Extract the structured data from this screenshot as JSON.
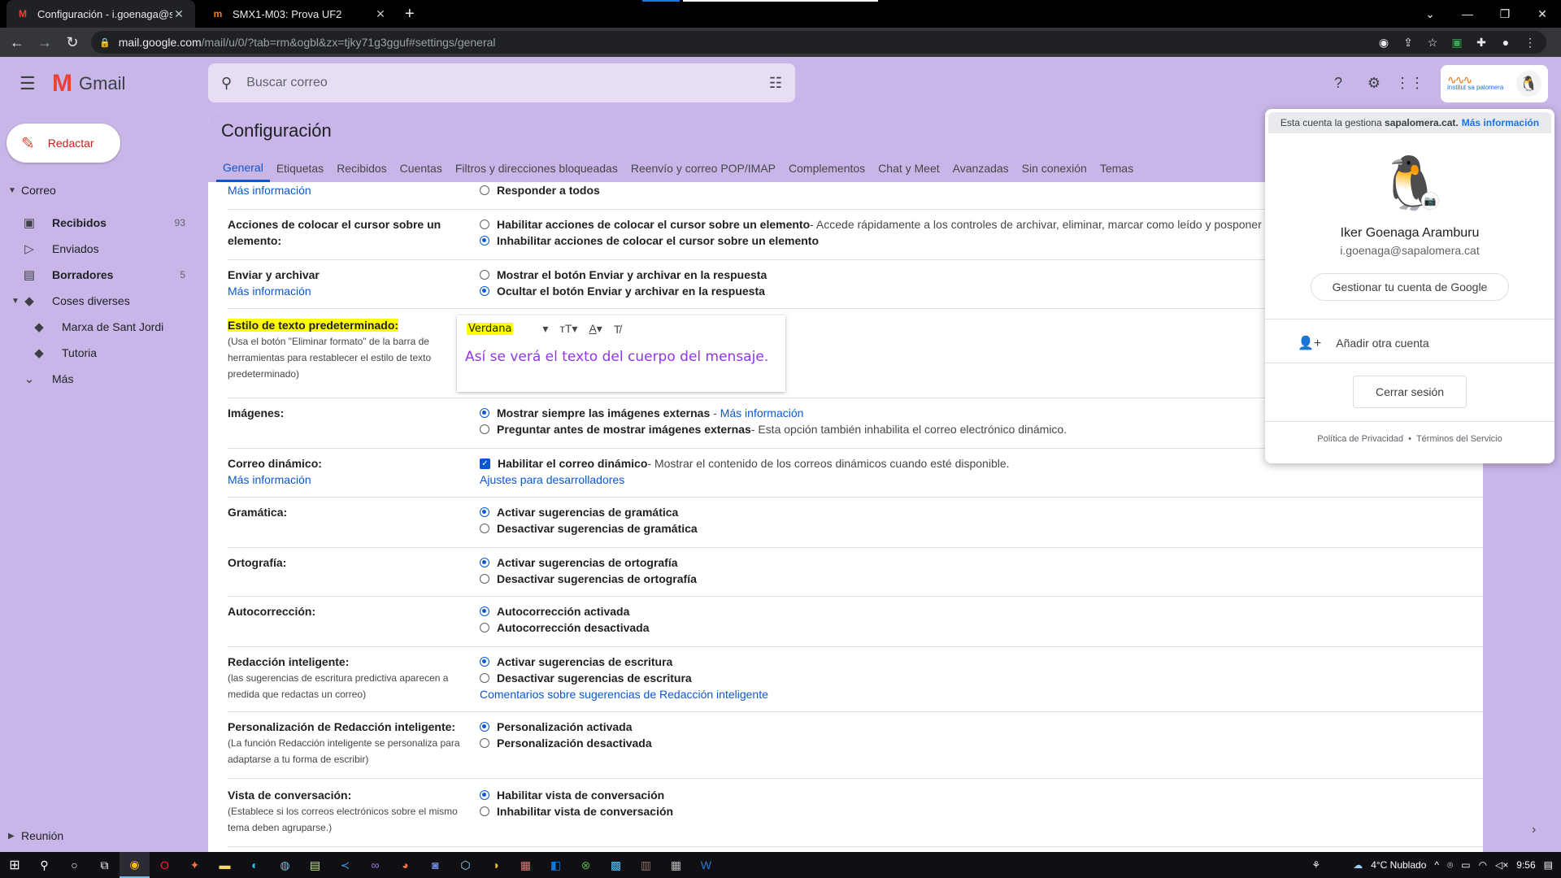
{
  "browser": {
    "tabs": [
      {
        "title": "Configuración - i.goenaga@sapa",
        "favicon": "gmail-m-icon",
        "active": true
      },
      {
        "title": "SMX1-M03: Prova UF2",
        "favicon": "moodle-m-icon",
        "active": false
      }
    ],
    "url_host": "mail.google.com",
    "url_path": "/mail/u/0/?tab=rm&ogbl&zx=tjky71g3gguf#settings/general"
  },
  "gmail": {
    "logo_text": "Gmail",
    "search_placeholder": "Buscar correo",
    "compose_label": "Redactar",
    "org_badge_text": "institut sa palomera"
  },
  "sidebar": {
    "section_mail": "Correo",
    "items": [
      {
        "label": "Recibidos",
        "count": "93",
        "icon": "inbox-icon",
        "bold": true
      },
      {
        "label": "Enviados",
        "count": "",
        "icon": "send-icon",
        "bold": false
      },
      {
        "label": "Borradores",
        "count": "5",
        "icon": "draft-icon",
        "bold": true
      },
      {
        "label": "Coses diverses",
        "count": "",
        "icon": "label-icon",
        "bold": false
      },
      {
        "label": "Marxa de Sant Jordi",
        "count": "",
        "icon": "label-icon",
        "bold": false
      },
      {
        "label": "Tutoria",
        "count": "",
        "icon": "label-icon",
        "bold": false
      },
      {
        "label": "Más",
        "count": "",
        "icon": "chevron-down-icon",
        "bold": false
      }
    ],
    "section_meet": "Reunión"
  },
  "settings": {
    "title": "Configuración",
    "tabs": [
      "General",
      "Etiquetas",
      "Recibidos",
      "Cuentas",
      "Filtros y direcciones bloqueadas",
      "Reenvío y correo POP/IMAP",
      "Complementos",
      "Chat y Meet",
      "Avanzadas",
      "Sin conexión",
      "Temas"
    ],
    "rows": {
      "reply": {
        "label_link": "Más información",
        "opt1": "Responder a todos"
      },
      "hover": {
        "label": "Acciones de colocar el cursor sobre un elemento:",
        "opt1": "Habilitar acciones de colocar el cursor sobre un elemento",
        "opt1_desc": " - Accede rápidamente a los controles de archivar, eliminar, marcar como leído y posponer",
        "opt2": "Inhabilitar acciones de colocar el cursor sobre un elemento"
      },
      "sendarchive": {
        "label": "Enviar y archivar",
        "label_link": "Más información",
        "opt1": "Mostrar el botón Enviar y archivar en la respuesta",
        "opt2": "Ocultar el botón Enviar y archivar en la respuesta"
      },
      "textstyle": {
        "label": "Estilo de texto predeterminado:",
        "sub": "(Usa el botón \"Eliminar formato\" de la barra de herramientas para restablecer el estilo de texto predeterminado)",
        "font": "Verdana",
        "preview": "Así se verá el texto del cuerpo del mensaje."
      },
      "images": {
        "label": "Imágenes:",
        "opt1": "Mostrar siempre las imágenes externas",
        "opt1_link": "Más información",
        "opt2": "Preguntar antes de mostrar imágenes externas",
        "opt2_desc": " - Esta opción también inhabilita el correo electrónico dinámico."
      },
      "dynamic": {
        "label": "Correo dinámico:",
        "label_link": "Más información",
        "opt1": "Habilitar el correo dinámico",
        "opt1_desc": " - Mostrar el contenido de los correos dinámicos cuando esté disponible.",
        "link2": "Ajustes para desarrolladores"
      },
      "grammar": {
        "label": "Gramática:",
        "opt1": "Activar sugerencias de gramática",
        "opt2": "Desactivar sugerencias de gramática"
      },
      "spelling": {
        "label": "Ortografía:",
        "opt1": "Activar sugerencias de ortografía",
        "opt2": "Desactivar sugerencias de ortografía"
      },
      "autocorrect": {
        "label": "Autocorrección:",
        "opt1": "Autocorrección activada",
        "opt2": "Autocorrección desactivada"
      },
      "smartcompose": {
        "label": "Redacción inteligente:",
        "sub": "(las sugerencias de escritura predictiva aparecen a medida que redactas un correo)",
        "opt1": "Activar sugerencias de escritura",
        "opt2": "Desactivar sugerencias de escritura",
        "link": "Comentarios sobre sugerencias de Redacción inteligente"
      },
      "personalization": {
        "label": "Personalización de Redacción inteligente:",
        "sub": "(La función Redacción inteligente se personaliza para adaptarse a tu forma de escribir)",
        "opt1": "Personalización activada",
        "opt2": "Personalización desactivada"
      },
      "conversation": {
        "label": "Vista de conversación:",
        "sub": "(Establece si los correos electrónicos sobre el mismo tema deben agruparse.)",
        "opt1": "Habilitar vista de conversación",
        "opt2": "Inhabilitar vista de conversación"
      }
    }
  },
  "account": {
    "managed_text": "Esta cuenta la gestiona",
    "managed_domain": "sapalomera.cat.",
    "managed_link": "Más información",
    "name": "Iker Goenaga Aramburu",
    "email": "i.goenaga@sapalomera.cat",
    "manage_button": "Gestionar tu cuenta de Google",
    "add_account": "Añadir otra cuenta",
    "sign_out": "Cerrar sesión",
    "privacy": "Política de Privacidad",
    "dot": "•",
    "terms": "Términos del Servicio"
  },
  "taskbar": {
    "weather": "4°C Nublado",
    "time": "9:56"
  },
  "colors": {
    "accent": "#0b57d0",
    "theme_bg": "#c9b6e8",
    "compose_red": "#c5221f",
    "preview_purple": "#9334e6",
    "highlight": "#ffff00"
  }
}
